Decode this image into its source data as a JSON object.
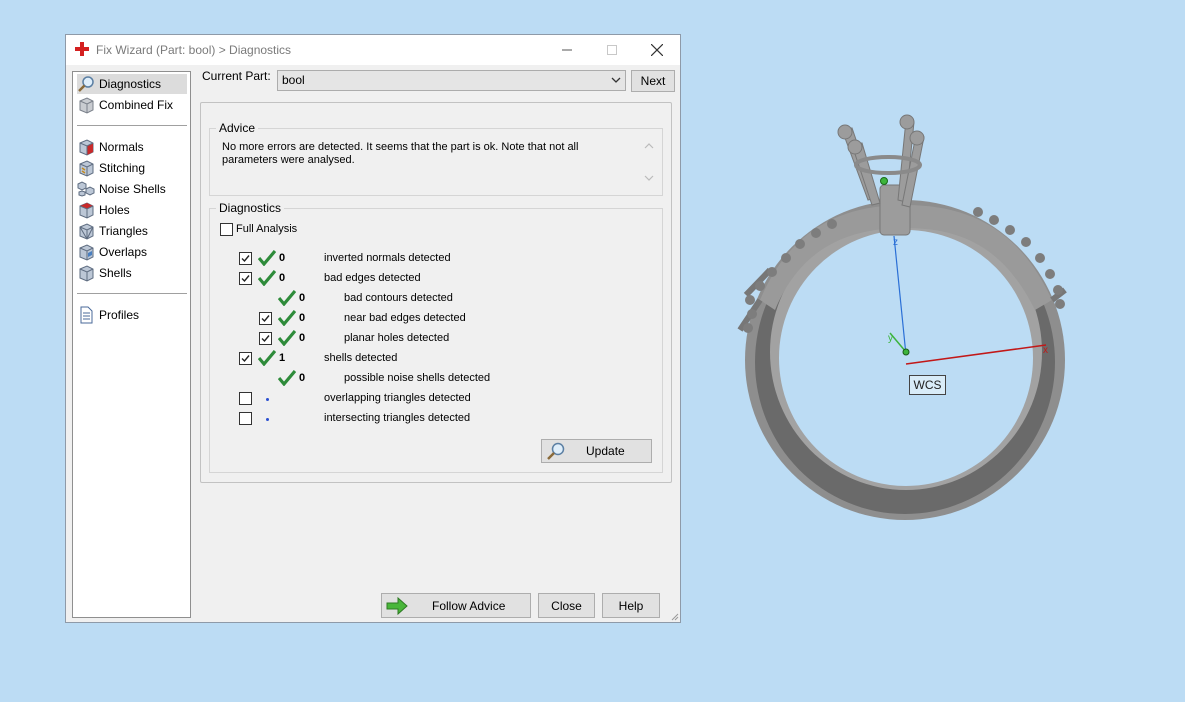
{
  "window": {
    "title": "Fix Wizard (Part: bool) > Diagnostics",
    "minimize_icon": "minimize-icon",
    "maximize_icon": "maximize-icon",
    "close_icon": "close-icon"
  },
  "sidebar": {
    "items": [
      {
        "label": "Diagnostics",
        "icon": "magnifier-icon",
        "selected": true
      },
      {
        "label": "Combined Fix",
        "icon": "cube-icon"
      },
      {
        "label": "Normals",
        "icon": "normals-cube-icon"
      },
      {
        "label": "Stitching",
        "icon": "stitching-cube-icon"
      },
      {
        "label": "Noise Shells",
        "icon": "noise-shells-icon"
      },
      {
        "label": "Holes",
        "icon": "holes-cube-icon"
      },
      {
        "label": "Triangles",
        "icon": "triangles-cube-icon"
      },
      {
        "label": "Overlaps",
        "icon": "overlaps-cube-icon"
      },
      {
        "label": "Shells",
        "icon": "shells-cube-icon"
      },
      {
        "label": "Profiles",
        "icon": "document-icon"
      }
    ]
  },
  "toolbar": {
    "current_part_label": "Current Part:",
    "current_part_value": "bool",
    "next_label": "Next"
  },
  "advice": {
    "title": "Advice",
    "text": "No more errors are detected. It seems that the part is ok. Note that not all parameters were analysed."
  },
  "diagnostics": {
    "title": "Diagnostics",
    "full_analysis_label": "Full Analysis",
    "full_analysis_checked": false,
    "rows": [
      {
        "checkbox": true,
        "checked": true,
        "status": "ok",
        "count": "0",
        "label": "inverted normals detected",
        "indent": 0
      },
      {
        "checkbox": true,
        "checked": true,
        "status": "ok",
        "count": "0",
        "label": "bad edges detected",
        "indent": 0
      },
      {
        "checkbox": false,
        "status": "ok",
        "count": "0",
        "label": "bad contours detected",
        "indent": 1
      },
      {
        "checkbox": true,
        "checked": true,
        "status": "ok",
        "count": "0",
        "label": "near bad edges detected",
        "indent": 1
      },
      {
        "checkbox": true,
        "checked": true,
        "status": "ok",
        "count": "0",
        "label": "planar holes detected",
        "indent": 1
      },
      {
        "checkbox": true,
        "checked": true,
        "status": "ok",
        "count": "1",
        "label": "shells detected",
        "indent": 0
      },
      {
        "checkbox": false,
        "status": "ok",
        "count": "0",
        "label": "possible noise shells detected",
        "indent": 1
      },
      {
        "checkbox": true,
        "checked": false,
        "status": "pending",
        "count": "",
        "label": "overlapping triangles detected",
        "indent": 0
      },
      {
        "checkbox": true,
        "checked": false,
        "status": "pending",
        "count": "",
        "label": "intersecting triangles detected",
        "indent": 0
      }
    ],
    "update_label": "Update"
  },
  "footer": {
    "follow_advice_label": "Follow Advice",
    "close_label": "Close",
    "help_label": "Help"
  },
  "viewport": {
    "wcs_label": "WCS",
    "axis_z": "z",
    "axis_x": "x",
    "axis_y": "y",
    "colors": {
      "z_axis": "#2a6fd6",
      "x_axis": "#c21818",
      "y_axis": "#3cb43c"
    }
  }
}
